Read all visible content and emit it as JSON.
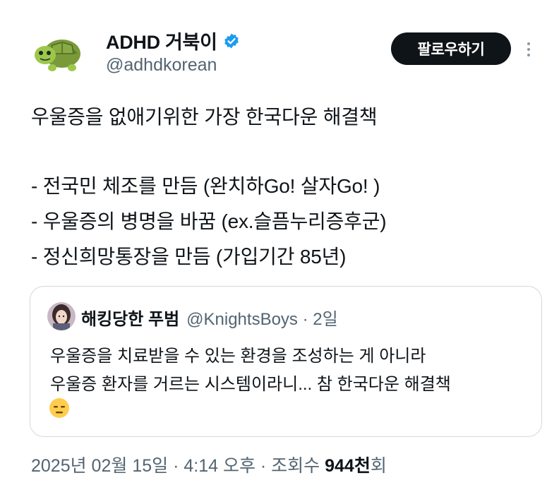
{
  "author": {
    "display_name": "ADHD 거북이",
    "handle": "@adhdkorean",
    "avatar_icon": "turtle-emoji-avatar",
    "verified_icon": "verified-badge-icon"
  },
  "follow_button": {
    "label": "팔로우하기"
  },
  "more_icon": "more-vertical-icon",
  "tweet": {
    "lines": [
      "우울증을 없애기위한 가장 한국다운 해결책",
      "- 전국민 체조를 만듬 (완치하Go! 살자Go! )",
      "- 우울증의 병명을 바꿈 (ex.슬픔누리증후군)",
      "- 정신희망통장을 만듬 (가입기간 85년)"
    ]
  },
  "quote": {
    "display_name": "해킹당한 푸범",
    "handle_time": "@KnightsBoys · 2일",
    "lines": [
      "우울증을 치료받을 수 있는 환경을 조성하는 게 아니라",
      "우울증 환자를 거르는 시스템이라니...  참 한국다운 해결책"
    ],
    "emoji": "expressionless-face-emoji"
  },
  "footer": {
    "date_time": "2025년 02월 15일 · 4:14 오후 · 조회수 ",
    "views": "944천",
    "views_suffix": "회"
  },
  "colors": {
    "text": "#0f1419",
    "secondary": "#536471",
    "verified": "#1d9bf0",
    "button": "#0f1419",
    "border": "#cfd9de"
  }
}
